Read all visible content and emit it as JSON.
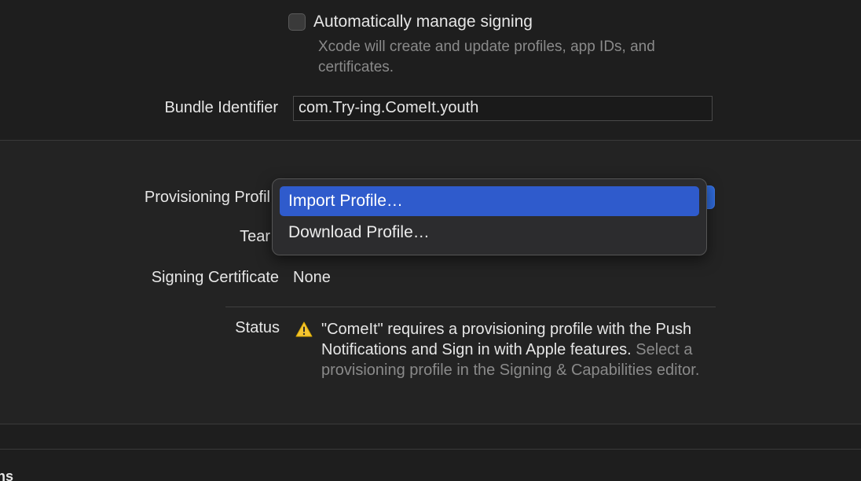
{
  "signing": {
    "auto_manage_label": "Automatically manage signing",
    "auto_manage_checked": false,
    "auto_manage_description": "Xcode will create and update profiles, app IDs, and certificates."
  },
  "bundle": {
    "label": "Bundle Identifier",
    "value": "com.Try-ing.ComeIt.youth"
  },
  "provisioning": {
    "label": "Provisioning Profil",
    "menu_items": [
      {
        "label": "Import Profile…",
        "highlighted": true
      },
      {
        "label": "Download Profile…",
        "highlighted": false
      }
    ]
  },
  "team": {
    "label": "Tear"
  },
  "certificate": {
    "label": "Signing Certificate",
    "value": "None"
  },
  "status": {
    "label": "Status",
    "message_main": "\"ComeIt\" requires a provisioning profile with the Push Notifications and Sign in with Apple features.",
    "message_hint": "Select a provisioning profile in the Signing & Capabilities editor."
  },
  "footer": {
    "cut_text": "ns"
  },
  "colors": {
    "accent": "#2f5bcc",
    "warning": "#f4c430",
    "background": "#1e1e1e"
  }
}
